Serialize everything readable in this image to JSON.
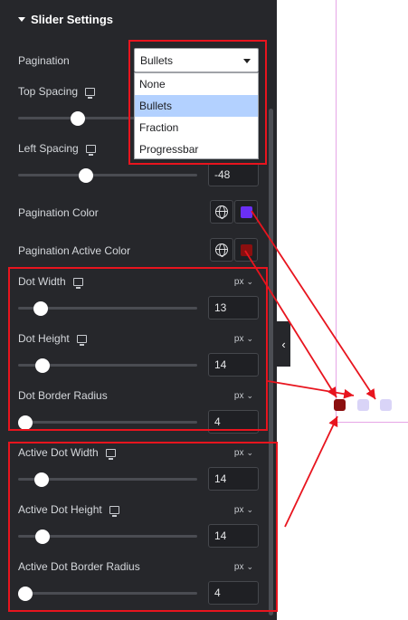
{
  "section": {
    "title": "Slider Settings"
  },
  "pagination": {
    "label": "Pagination",
    "selected": "Bullets",
    "options": [
      "None",
      "Bullets",
      "Fraction",
      "Progressbar"
    ]
  },
  "top_spacing": {
    "label": "Top Spacing"
  },
  "left_spacing": {
    "label": "Left Spacing",
    "value": "-48"
  },
  "pagination_color": {
    "label": "Pagination Color",
    "color": "#6b2ff5"
  },
  "pagination_active_color": {
    "label": "Pagination Active Color",
    "color": "#8b0f0f"
  },
  "dot_width": {
    "label": "Dot Width",
    "unit": "px",
    "value": "13"
  },
  "dot_height": {
    "label": "Dot Height",
    "unit": "px",
    "value": "14"
  },
  "dot_border_radius": {
    "label": "Dot Border Radius",
    "unit": "px",
    "value": "4"
  },
  "active_dot_width": {
    "label": "Active Dot Width",
    "unit": "px",
    "value": "14"
  },
  "active_dot_height": {
    "label": "Active Dot Height",
    "unit": "px",
    "value": "14"
  },
  "active_dot_border_radius": {
    "label": "Active Dot Border Radius",
    "unit": "px",
    "value": "4"
  },
  "preview": {
    "active_dot_color": "#8b0f0f",
    "inactive_dot_color": "#d9d4f7"
  },
  "icons": {
    "collapse": "chevron-left-icon",
    "responsive": "monitor-icon",
    "global": "globe-icon"
  }
}
